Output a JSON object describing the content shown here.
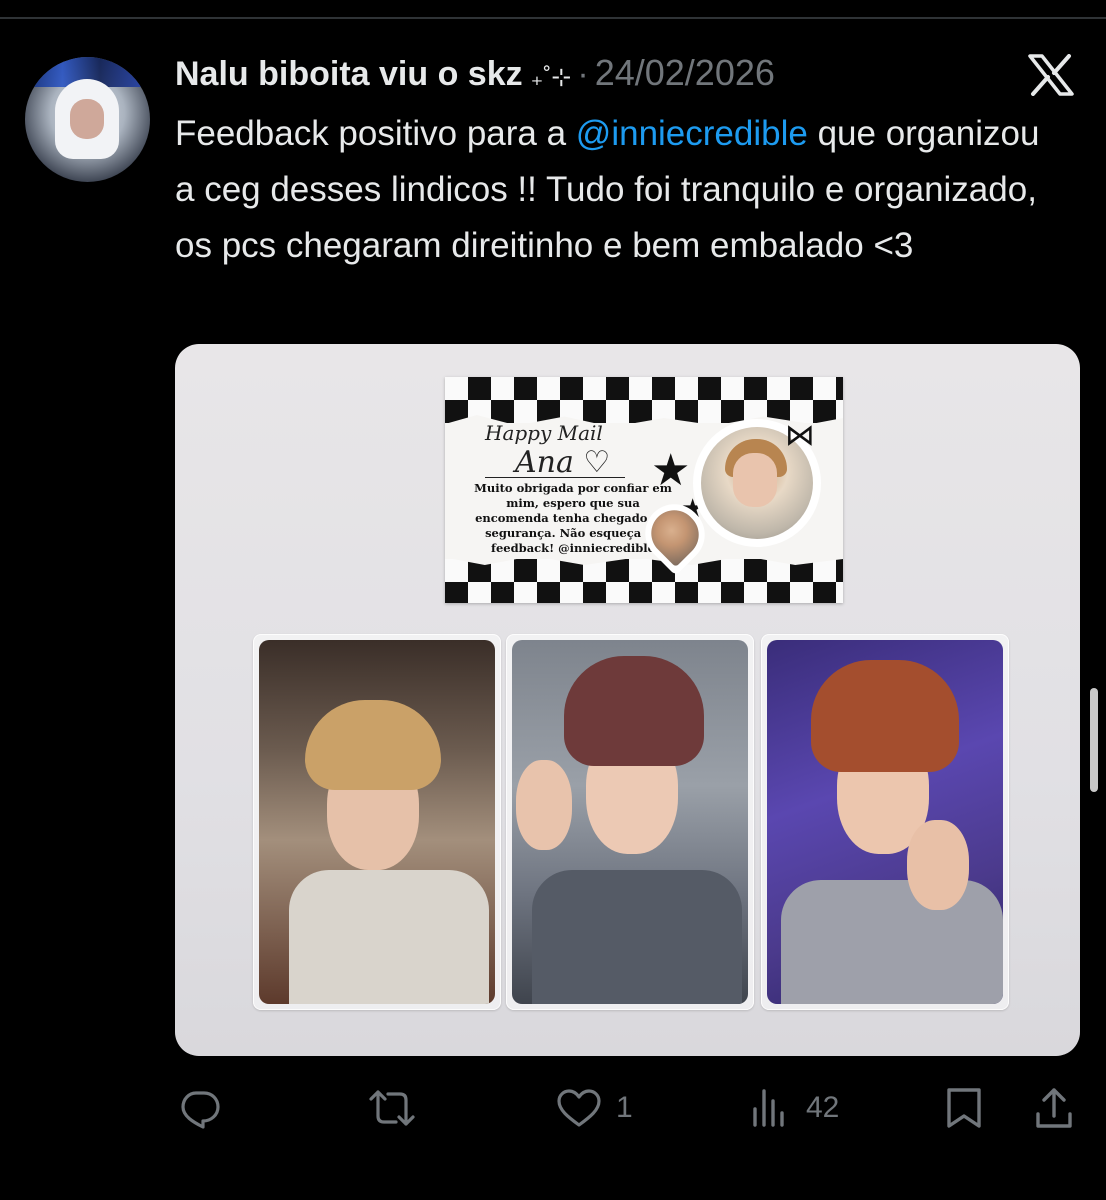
{
  "tweet": {
    "author_name": "Nalu biboita viu o skz",
    "author_decoration": "₊˚⊹",
    "separator": "·",
    "date": "24/02/2026",
    "text_before_mention": "Feedback positivo para a ",
    "mention": "@inniecredible",
    "text_after_mention": " que organizou a ceg desses lindicos !! Tudo foi tranquilo e organizado, os pcs chegaram direitinho e bem embalado <3"
  },
  "media": {
    "card": {
      "title": "Happy Mail",
      "recipient": "Ana ♡",
      "message": "Muito obrigada por confiar em mim, espero que sua encomenda tenha chegado em segurança. Não esqueça do feedback! @inniecredible"
    }
  },
  "actions": {
    "reply_icon": "reply-icon",
    "retweet_icon": "retweet-icon",
    "like_icon": "heart-icon",
    "like_count": "1",
    "views_icon": "views-icon",
    "views_count": "42",
    "bookmark_icon": "bookmark-icon",
    "share_icon": "share-icon"
  },
  "brand": {
    "logo": "x-logo-icon",
    "mention_color": "#1d9bf0",
    "muted_color": "#71767b",
    "text_color": "#e7e9ea"
  }
}
